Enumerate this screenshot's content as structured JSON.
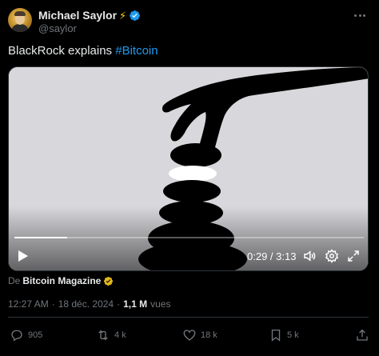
{
  "author": {
    "display_name": "Michael Saylor",
    "emoji": "⚡",
    "handle": "@saylor",
    "verified_color": "#1d9bf0"
  },
  "text": {
    "body": "BlackRock explains ",
    "hashtag": "#Bitcoin"
  },
  "video": {
    "elapsed": "0:29",
    "duration": "3:13",
    "time_display": "0:29 / 3:13",
    "progress_fraction": 0.15,
    "icons": [
      "play-icon",
      "volume-icon",
      "settings-icon",
      "fullscreen-icon"
    ]
  },
  "attribution": {
    "prefix": "De",
    "source": "Bitcoin Magazine",
    "badge_color": "#e2b719"
  },
  "meta": {
    "time": "12:27 AM",
    "sep1": "·",
    "date": "18 déc. 2024",
    "sep2": "·",
    "views_count": "1,1 M",
    "views_label": "vues"
  },
  "actions": {
    "replies": "905",
    "reposts": "4 k",
    "likes": "18 k",
    "bookmarks": "5 k"
  },
  "colors": {
    "background": "#000000",
    "text": "#e7e9ea",
    "muted": "#71767b",
    "accent": "#1d9bf0"
  }
}
